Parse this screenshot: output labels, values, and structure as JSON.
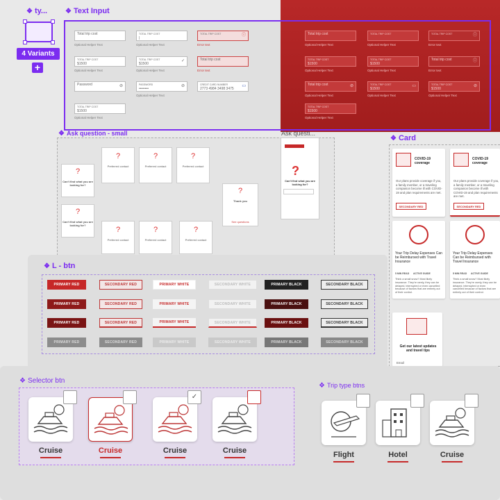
{
  "component": {
    "title": "ty...",
    "variants_badge": "4 Variants",
    "add_symbol": "+"
  },
  "text_input": {
    "title": "Text Input",
    "light": {
      "total_trip_cost": "Total trip cost",
      "field_label": "TOTAL TRIP COST",
      "value": "$1500",
      "cursor_value": "|",
      "helper": "Optional Helper Text",
      "error": "Error text",
      "password": "Password",
      "password_label": "PASSWORD",
      "password_value": "••••••••",
      "card_label": "CREDIT CARD NUMBER",
      "card_value": "2773 4984 3498 3475"
    },
    "dark": {
      "total_trip_cost": "Total trip cost",
      "field_label": "TOTAL TRIP COST",
      "value": "$1500",
      "helper": "Optional Helper Text",
      "error": "Error text"
    }
  },
  "ask_question": {
    "title": "Ask question - small",
    "title_large": "Ask questi...",
    "preferred": "Preferred contact",
    "cant_find": "Can't find what you are looking for?",
    "thank_you": "Thank you",
    "see_questions": "See questions"
  },
  "card": {
    "title": "Card",
    "covid_title": "COVID-19 coverage",
    "covid_body": "Our plans provide coverage if you, a family member, or a traveling companion become ill with COVID-19 and plan requirements are met.",
    "secondary_red": "SECONDARY RED",
    "delay_title": "Your Trip Delay Expenses Can be Reimbursed with Travel Insurance",
    "tag_one": "5 MIN READ",
    "tag_two": "ACTIVE GUIDE",
    "delay_body": "Think a small snow? Most likely insurance. They're rarely, they can be delayed, interrupted or even cancelled because of factors that are entirely out of their control.",
    "updates": "Get our latest updates and travel tips",
    "email": "Email"
  },
  "buttons": {
    "title": "L - btn",
    "primary_red": "PRIMARY RED",
    "secondary_red": "SECONDARY RED",
    "primary_white": "PRIMARY WHITE",
    "secondary_white": "SECONDARY WHITE",
    "primary_black": "PRIMARY BLACK",
    "secondary_black": "SECONDARY BLACK"
  },
  "selector": {
    "title": "Selector btn",
    "items": [
      {
        "label": "Cruise",
        "state": "default"
      },
      {
        "label": "Cruise",
        "state": "active"
      },
      {
        "label": "Cruise",
        "state": "checked"
      },
      {
        "label": "Cruise",
        "state": "hover"
      }
    ],
    "check_symbol": "✓"
  },
  "trip_type": {
    "title": "Trip type btns",
    "items": [
      {
        "label": "Flight"
      },
      {
        "label": "Hotel"
      },
      {
        "label": "Cruise"
      }
    ]
  },
  "colors": {
    "accent": "#7b2cf0",
    "brand_red": "#c62828",
    "dark_red": "#a51f1f"
  }
}
